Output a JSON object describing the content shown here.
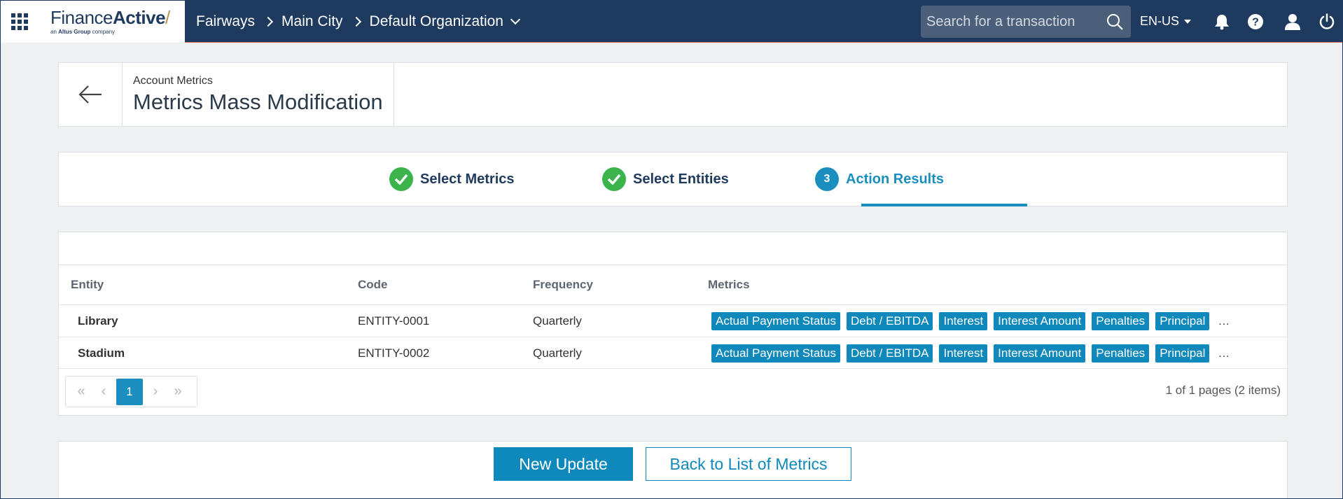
{
  "header": {
    "logo": {
      "name_light": "Finance",
      "name_bold": "Active",
      "tagline_prefix": "an",
      "tagline_brand": "Altus Group",
      "tagline_suffix": "company"
    },
    "breadcrumb": [
      "Fairways",
      "Main City",
      "Default Organization"
    ],
    "search": {
      "placeholder": "Search for a transaction",
      "value": ""
    },
    "language": "EN-US",
    "icons": [
      "apps-grid-icon",
      "search-icon",
      "bell-icon",
      "help-icon",
      "user-icon",
      "power-icon"
    ]
  },
  "page": {
    "subtitle": "Account Metrics",
    "title": "Metrics Mass Modification"
  },
  "steps": [
    {
      "label": "Select Metrics",
      "status": "done"
    },
    {
      "label": "Select Entities",
      "status": "done"
    },
    {
      "number": "3",
      "label": "Action Results",
      "status": "active"
    }
  ],
  "table": {
    "columns": [
      "Entity",
      "Code",
      "Frequency",
      "Metrics"
    ],
    "rows": [
      {
        "entity": "Library",
        "code": "ENTITY-0001",
        "frequency": "Quarterly",
        "metrics": [
          "Actual Payment Status",
          "Debt / EBITDA",
          "Interest",
          "Interest Amount",
          "Penalties",
          "Principal"
        ],
        "overflow": "…"
      },
      {
        "entity": "Stadium",
        "code": "ENTITY-0002",
        "frequency": "Quarterly",
        "metrics": [
          "Actual Payment Status",
          "Debt / EBITDA",
          "Interest",
          "Interest Amount",
          "Penalties",
          "Principal"
        ],
        "overflow": "…"
      }
    ],
    "pager": {
      "current_page": "1",
      "info": "1 of 1 pages (2 items)"
    }
  },
  "actions": {
    "primary": "New Update",
    "secondary": "Back to List of Metrics"
  },
  "colors": {
    "header_bg": "#1f3a5f",
    "accent": "#0f88bb",
    "success": "#3cb44b"
  }
}
